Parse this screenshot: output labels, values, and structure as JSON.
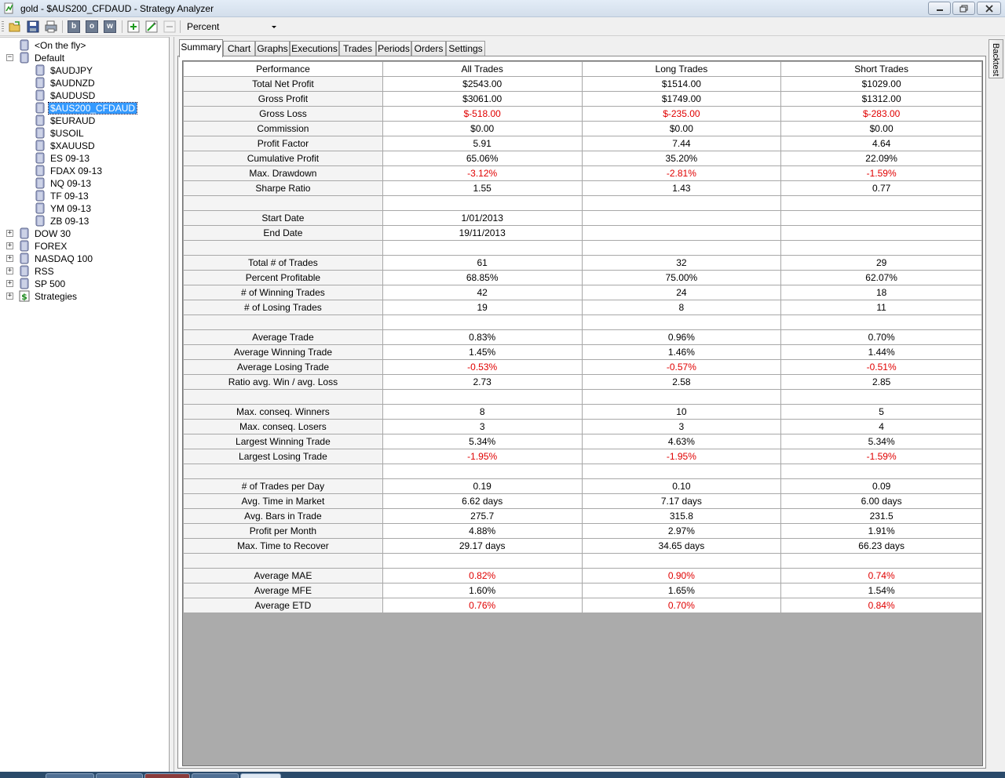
{
  "window": {
    "title": "gold - $AUS200_CFDAUD - Strategy Analyzer"
  },
  "toolbar": {
    "display_mode": "Percent",
    "format_buttons": [
      "b",
      "o",
      "w"
    ]
  },
  "tree": [
    {
      "label": "<On the fly>",
      "level": 1,
      "expander": "",
      "selected": false
    },
    {
      "label": "Default",
      "level": 0,
      "expander": "−",
      "selected": false
    },
    {
      "label": "$AUDJPY",
      "level": 2,
      "expander": "",
      "selected": false
    },
    {
      "label": "$AUDNZD",
      "level": 2,
      "expander": "",
      "selected": false
    },
    {
      "label": "$AUDUSD",
      "level": 2,
      "expander": "",
      "selected": false
    },
    {
      "label": "$AUS200_CFDAUD",
      "level": 2,
      "expander": "",
      "selected": true
    },
    {
      "label": "$EURAUD",
      "level": 2,
      "expander": "",
      "selected": false
    },
    {
      "label": "$USOIL",
      "level": 2,
      "expander": "",
      "selected": false
    },
    {
      "label": "$XAUUSD",
      "level": 2,
      "expander": "",
      "selected": false
    },
    {
      "label": "ES 09-13",
      "level": 2,
      "expander": "",
      "selected": false
    },
    {
      "label": "FDAX 09-13",
      "level": 2,
      "expander": "",
      "selected": false
    },
    {
      "label": "NQ 09-13",
      "level": 2,
      "expander": "",
      "selected": false
    },
    {
      "label": "TF 09-13",
      "level": 2,
      "expander": "",
      "selected": false
    },
    {
      "label": "YM 09-13",
      "level": 2,
      "expander": "",
      "selected": false
    },
    {
      "label": "ZB 09-13",
      "level": 2,
      "expander": "",
      "selected": false
    },
    {
      "label": "DOW 30",
      "level": 0,
      "expander": "+",
      "selected": false
    },
    {
      "label": "FOREX",
      "level": 0,
      "expander": "+",
      "selected": false
    },
    {
      "label": "NASDAQ 100",
      "level": 0,
      "expander": "+",
      "selected": false
    },
    {
      "label": "RSS",
      "level": 0,
      "expander": "+",
      "selected": false
    },
    {
      "label": "SP 500",
      "level": 0,
      "expander": "+",
      "selected": false
    },
    {
      "label": "Strategies",
      "level": 0,
      "expander": "+",
      "selected": false,
      "icon": "strategy"
    }
  ],
  "tabs": [
    "Summary",
    "Chart",
    "Graphs",
    "Executions",
    "Trades",
    "Periods",
    "Orders",
    "Settings"
  ],
  "active_tab": "Summary",
  "side_tab": "Backtest",
  "summary": {
    "headers": [
      "Performance",
      "All Trades",
      "Long Trades",
      "Short Trades"
    ],
    "rows": [
      {
        "label": "Total Net Profit",
        "values": [
          "$2543.00",
          "$1514.00",
          "$1029.00"
        ],
        "negative": false
      },
      {
        "label": "Gross Profit",
        "values": [
          "$3061.00",
          "$1749.00",
          "$1312.00"
        ],
        "negative": false
      },
      {
        "label": "Gross Loss",
        "values": [
          "$-518.00",
          "$-235.00",
          "$-283.00"
        ],
        "negative": true
      },
      {
        "label": "Commission",
        "values": [
          "$0.00",
          "$0.00",
          "$0.00"
        ],
        "negative": false
      },
      {
        "label": "Profit Factor",
        "values": [
          "5.91",
          "7.44",
          "4.64"
        ],
        "negative": false
      },
      {
        "label": "Cumulative Profit",
        "values": [
          "65.06%",
          "35.20%",
          "22.09%"
        ],
        "negative": false
      },
      {
        "label": "Max. Drawdown",
        "values": [
          "-3.12%",
          "-2.81%",
          "-1.59%"
        ],
        "negative": true
      },
      {
        "label": "Sharpe Ratio",
        "values": [
          "1.55",
          "1.43",
          "0.77"
        ],
        "negative": false
      },
      {
        "label": "",
        "values": [
          "",
          "",
          ""
        ],
        "negative": false
      },
      {
        "label": "Start Date",
        "values": [
          "1/01/2013",
          "",
          ""
        ],
        "negative": false
      },
      {
        "label": "End Date",
        "values": [
          "19/11/2013",
          "",
          ""
        ],
        "negative": false
      },
      {
        "label": "",
        "values": [
          "",
          "",
          ""
        ],
        "negative": false
      },
      {
        "label": "Total # of Trades",
        "values": [
          "61",
          "32",
          "29"
        ],
        "negative": false
      },
      {
        "label": "Percent Profitable",
        "values": [
          "68.85%",
          "75.00%",
          "62.07%"
        ],
        "negative": false
      },
      {
        "label": "# of Winning Trades",
        "values": [
          "42",
          "24",
          "18"
        ],
        "negative": false
      },
      {
        "label": "# of Losing Trades",
        "values": [
          "19",
          "8",
          "11"
        ],
        "negative": false
      },
      {
        "label": "",
        "values": [
          "",
          "",
          ""
        ],
        "negative": false
      },
      {
        "label": "Average Trade",
        "values": [
          "0.83%",
          "0.96%",
          "0.70%"
        ],
        "negative": false
      },
      {
        "label": "Average Winning Trade",
        "values": [
          "1.45%",
          "1.46%",
          "1.44%"
        ],
        "negative": false
      },
      {
        "label": "Average Losing Trade",
        "values": [
          "-0.53%",
          "-0.57%",
          "-0.51%"
        ],
        "negative": true
      },
      {
        "label": "Ratio avg. Win / avg. Loss",
        "values": [
          "2.73",
          "2.58",
          "2.85"
        ],
        "negative": false
      },
      {
        "label": "",
        "values": [
          "",
          "",
          ""
        ],
        "negative": false
      },
      {
        "label": "Max. conseq. Winners",
        "values": [
          "8",
          "10",
          "5"
        ],
        "negative": false
      },
      {
        "label": "Max. conseq. Losers",
        "values": [
          "3",
          "3",
          "4"
        ],
        "negative": false
      },
      {
        "label": "Largest Winning Trade",
        "values": [
          "5.34%",
          "4.63%",
          "5.34%"
        ],
        "negative": false
      },
      {
        "label": "Largest Losing Trade",
        "values": [
          "-1.95%",
          "-1.95%",
          "-1.59%"
        ],
        "negative": true
      },
      {
        "label": "",
        "values": [
          "",
          "",
          ""
        ],
        "negative": false
      },
      {
        "label": "# of Trades per Day",
        "values": [
          "0.19",
          "0.10",
          "0.09"
        ],
        "negative": false
      },
      {
        "label": "Avg. Time in Market",
        "values": [
          "6.62 days",
          "7.17 days",
          "6.00 days"
        ],
        "negative": false
      },
      {
        "label": "Avg. Bars in Trade",
        "values": [
          "275.7",
          "315.8",
          "231.5"
        ],
        "negative": false
      },
      {
        "label": "Profit per Month",
        "values": [
          "4.88%",
          "2.97%",
          "1.91%"
        ],
        "negative": false
      },
      {
        "label": "Max. Time to Recover",
        "values": [
          "29.17 days",
          "34.65 days",
          "66.23 days"
        ],
        "negative": false
      },
      {
        "label": "",
        "values": [
          "",
          "",
          ""
        ],
        "negative": false
      },
      {
        "label": "Average MAE",
        "values": [
          "0.82%",
          "0.90%",
          "0.74%"
        ],
        "negative": true
      },
      {
        "label": "Average MFE",
        "values": [
          "1.60%",
          "1.65%",
          "1.54%"
        ],
        "negative": false
      },
      {
        "label": "Average ETD",
        "values": [
          "0.76%",
          "0.70%",
          "0.84%"
        ],
        "negative": true
      }
    ]
  },
  "colors": {
    "negative_text": "#e00000",
    "selection": "#3399ff",
    "grid_background": "#ababab"
  }
}
